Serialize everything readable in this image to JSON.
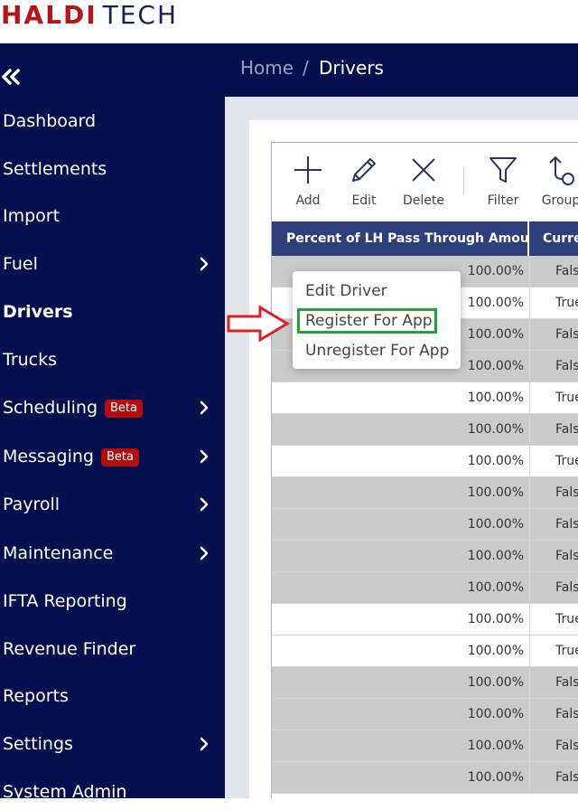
{
  "logo": {
    "part1": "HALDI",
    "part2": "TECH"
  },
  "sidebar": {
    "items": [
      {
        "label": "Dashboard",
        "chevron": false,
        "badge": ""
      },
      {
        "label": "Settlements",
        "chevron": false,
        "badge": ""
      },
      {
        "label": "Import",
        "chevron": false,
        "badge": ""
      },
      {
        "label": "Fuel",
        "chevron": true,
        "badge": ""
      },
      {
        "label": "Drivers",
        "chevron": false,
        "badge": "",
        "active": true
      },
      {
        "label": "Trucks",
        "chevron": false,
        "badge": ""
      },
      {
        "label": "Scheduling",
        "chevron": true,
        "badge": "Beta"
      },
      {
        "label": "Messaging",
        "chevron": true,
        "badge": "Beta"
      },
      {
        "label": "Payroll",
        "chevron": true,
        "badge": ""
      },
      {
        "label": "Maintenance",
        "chevron": true,
        "badge": ""
      },
      {
        "label": "IFTA Reporting",
        "chevron": false,
        "badge": ""
      },
      {
        "label": "Revenue Finder",
        "chevron": false,
        "badge": ""
      },
      {
        "label": "Reports",
        "chevron": false,
        "badge": ""
      },
      {
        "label": "Settings",
        "chevron": true,
        "badge": ""
      },
      {
        "label": "System Admin",
        "chevron": false,
        "badge": ""
      }
    ]
  },
  "breadcrumb": {
    "home": "Home",
    "separator": "/",
    "current": "Drivers"
  },
  "toolbar": {
    "add": "Add",
    "edit": "Edit",
    "delete": "Delete",
    "filter": "Filter",
    "group": "Group"
  },
  "grid": {
    "columns": [
      "Percent of LH Pass Through Amount",
      "Current"
    ],
    "rows": [
      {
        "pct": "100.00%",
        "current": "False"
      },
      {
        "pct": "100.00%",
        "current": "True"
      },
      {
        "pct": "100.00%",
        "current": "False"
      },
      {
        "pct": "100.00%",
        "current": "False"
      },
      {
        "pct": "100.00%",
        "current": "True"
      },
      {
        "pct": "100.00%",
        "current": "False"
      },
      {
        "pct": "100.00%",
        "current": "True"
      },
      {
        "pct": "100.00%",
        "current": "False"
      },
      {
        "pct": "100.00%",
        "current": "False"
      },
      {
        "pct": "100.00%",
        "current": "False"
      },
      {
        "pct": "100.00%",
        "current": "False"
      },
      {
        "pct": "100.00%",
        "current": "True"
      },
      {
        "pct": "100.00%",
        "current": "True"
      },
      {
        "pct": "100.00%",
        "current": "False"
      },
      {
        "pct": "100.00%",
        "current": "False"
      },
      {
        "pct": "100.00%",
        "current": "False"
      },
      {
        "pct": "100.00%",
        "current": "False"
      }
    ]
  },
  "context_menu": {
    "items": [
      "Edit Driver",
      "Register For App",
      "Unregister For App"
    ]
  },
  "colors": {
    "sidebar_bg": "#03104d",
    "header_bg": "#03104d",
    "column_header_bg": "#2e3f7a",
    "badge_bg": "#b30d0d",
    "logo_red": "#b4141c",
    "logo_navy": "#1a1f5c",
    "highlight_green": "#22a33a",
    "arrow_red": "#e02020"
  }
}
